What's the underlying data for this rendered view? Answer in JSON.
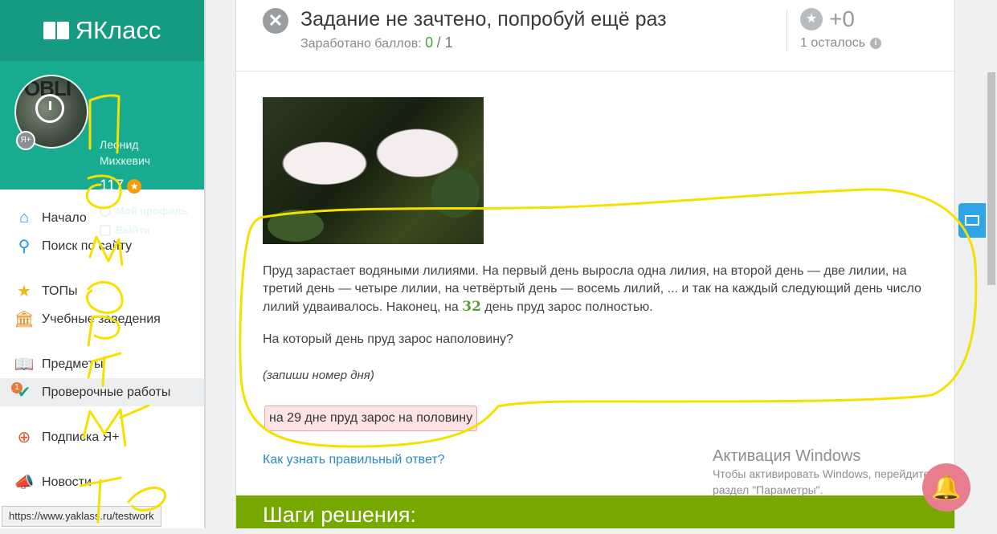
{
  "sidebar": {
    "brand": "ЯКласс",
    "user": {
      "name_line1": "Леонид",
      "name_line2": "Михкевич",
      "points": "117",
      "avatar_text": "OBLI",
      "plus_badge": "Я+",
      "profile_link": "Мой профиль",
      "logout_link": "Выйти"
    },
    "nav": [
      {
        "label": "Начало",
        "icon": "home-icon",
        "color": "#1a9be0"
      },
      {
        "label": "Поиск по сайту",
        "icon": "search-icon",
        "color": "#1a9be0"
      },
      {
        "label": "ТОПы",
        "icon": "star-icon",
        "color": "#f2b51c"
      },
      {
        "label": "Учебные заведения",
        "icon": "institution-icon",
        "color": "#e08a1a"
      },
      {
        "label": "Предметы",
        "icon": "book-icon",
        "color": "#3c8a3c"
      },
      {
        "label": "Проверочные работы",
        "icon": "check-icon",
        "color": "#18a38a",
        "badge": "1"
      },
      {
        "label": "Подписка Я+",
        "icon": "subscription-icon",
        "color": "#e0562a"
      },
      {
        "label": "Новости",
        "icon": "news-icon",
        "color": "#555555"
      }
    ],
    "status_url": "https://www.yaklass.ru/testwork"
  },
  "task": {
    "title": "Задание не зачтено, попробуй ещё раз",
    "earned_label": "Заработано баллов:",
    "earned_value": "0",
    "earned_total": "/ 1",
    "bonus": "+0",
    "attempts_left": "1 осталось",
    "text_part1": "Пруд зарастает водяными лилиями. На первый день выросла одна лилия, на второй день — две лилии, на третий день — четыре лилии, на четвёртый день — восемь лилий, ... и так на каждый следующий день число лилий удваивалось. Наконец, на",
    "text_number": "32",
    "text_part2": "день пруд зарос полностью.",
    "question": "На который день пруд зарос наполовину?",
    "hint": "(запиши номер дня)",
    "answer": "на 29 дне пруд зарос на половину",
    "howto_link": "Как узнать правильный ответ?",
    "steps_title": "Шаги решения:"
  },
  "windows": {
    "title": "Активация Windows",
    "line1": "Чтобы активировать Windows, перейдите",
    "line2": "раздел \"Параметры\"."
  },
  "colors": {
    "brand_header": "#149b82",
    "user_panel": "#17ab8f",
    "steps_bar": "#76a800",
    "answer_wrong_bg": "#fde4e4",
    "link": "#2a8bc7",
    "scribble": "#f4e100"
  }
}
